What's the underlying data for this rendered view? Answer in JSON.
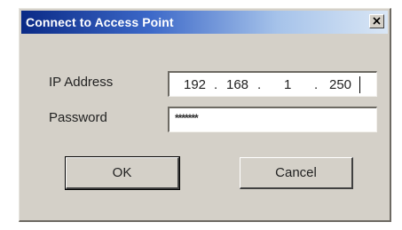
{
  "dialog": {
    "title": "Connect to Access Point",
    "close_symbol": "close-icon"
  },
  "form": {
    "ip_label": "IP Address",
    "ip_octets": [
      "192",
      "168",
      "1",
      "250"
    ],
    "ip_separator": ".",
    "password_label": "Password",
    "password_value": "*******"
  },
  "buttons": {
    "ok_label": "OK",
    "cancel_label": "Cancel"
  },
  "colors": {
    "titlebar_start": "#0a2a86",
    "titlebar_end": "#d9e6f5",
    "dialog_face": "#d4d0c8"
  }
}
